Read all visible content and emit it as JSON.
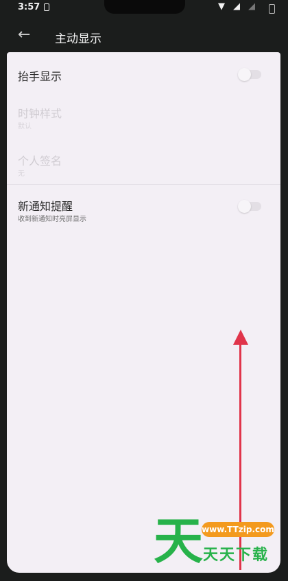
{
  "status_bar": {
    "time": "3:57",
    "icons": [
      "sim-icon",
      "wifi-icon",
      "signal-icon",
      "battery-icon"
    ]
  },
  "header": {
    "back_icon": "arrow-left",
    "title": "主动显示"
  },
  "settings": {
    "raise_to_wake": {
      "label": "抬手显示",
      "enabled": false
    },
    "clock_style": {
      "label": "时钟样式",
      "value": "默认",
      "disabled": true
    },
    "personal_signature": {
      "label": "个人签名",
      "value": "无",
      "disabled": true
    },
    "new_notification": {
      "label": "新通知提醒",
      "sublabel": "收到新通知时亮屏显示",
      "enabled": false
    }
  },
  "overlay": {
    "arrow_color": "#e0344a",
    "watermark": {
      "char": "天",
      "url": "www.TTzip.com",
      "name": "天天下载"
    }
  },
  "colors": {
    "background": "#1b1d1c",
    "panel": "#f3eff5",
    "watermark_green": "#27b24a",
    "watermark_orange": "#f39a1e"
  }
}
